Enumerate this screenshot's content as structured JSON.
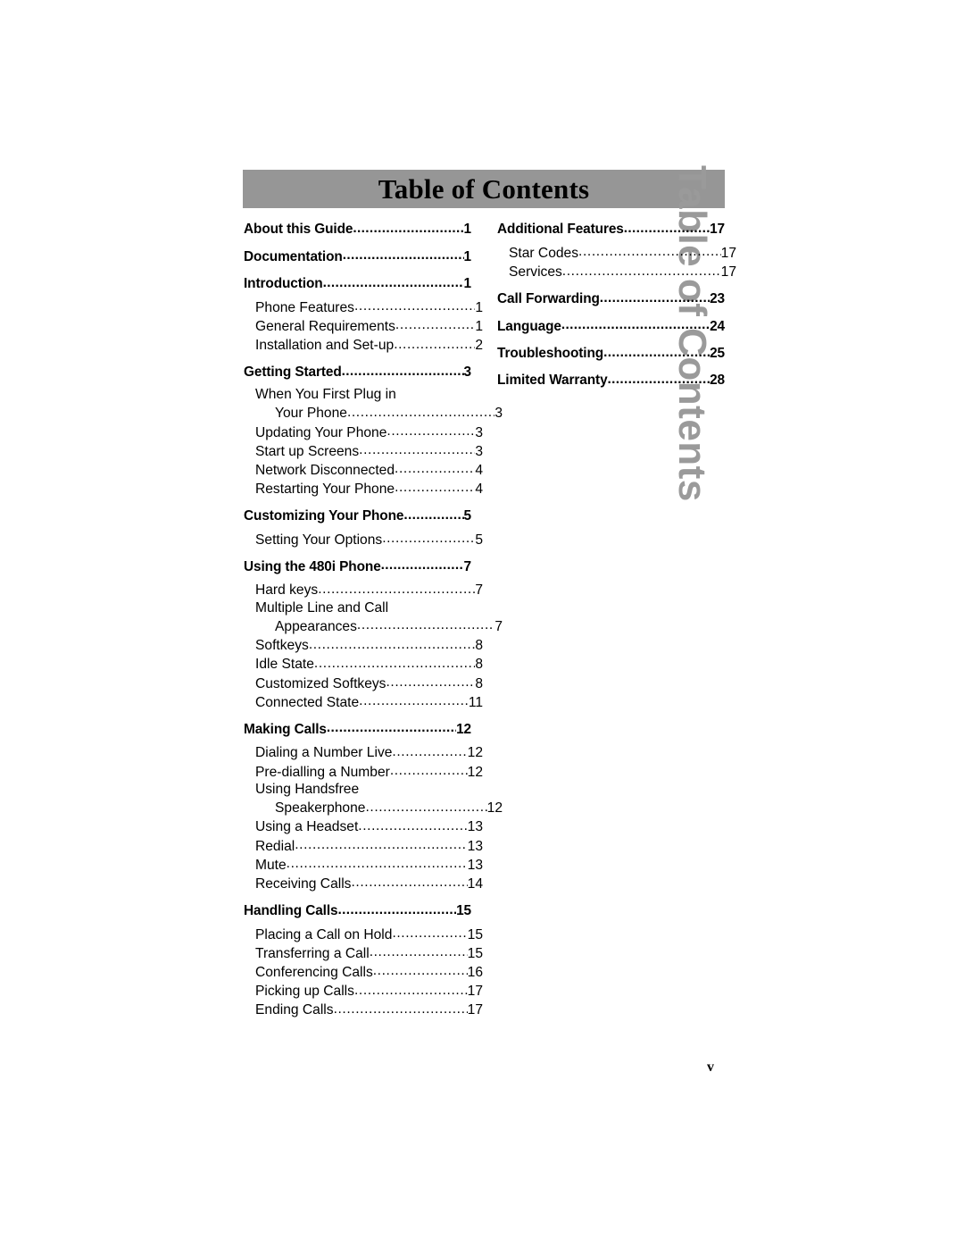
{
  "document": {
    "title": "Table of Contents",
    "side_tab_label": "Table of Contents",
    "folio": "v",
    "banner_color": "#969696",
    "side_tab_color": "#9a9a9a",
    "text_color": "#000000"
  },
  "toc": {
    "left_column": [
      {
        "level": 1,
        "label": "About this Guide",
        "page": "1"
      },
      {
        "level": 1,
        "label": "Documentation",
        "page": "1"
      },
      {
        "level": 1,
        "label": "Introduction",
        "page": "1"
      },
      {
        "level": 2,
        "label": "Phone Features",
        "page": "1"
      },
      {
        "level": 2,
        "label": "General Requirements",
        "page": "1"
      },
      {
        "level": 2,
        "label": "Installation and Set-up",
        "page": "2"
      },
      {
        "level": 1,
        "label": "Getting Started",
        "page": "3"
      },
      {
        "level": 2,
        "label": "When You First Plug in",
        "page": "",
        "wrap_first": true
      },
      {
        "level": 2,
        "label": "Your Phone",
        "page": "3",
        "continuation": true
      },
      {
        "level": 2,
        "label": "Updating Your Phone",
        "page": "3"
      },
      {
        "level": 2,
        "label": "Start up Screens",
        "page": "3"
      },
      {
        "level": 2,
        "label": "Network Disconnected",
        "page": "4"
      },
      {
        "level": 2,
        "label": "Restarting Your Phone",
        "page": "4"
      },
      {
        "level": 1,
        "label": "Customizing Your Phone",
        "page": "5"
      },
      {
        "level": 2,
        "label": "Setting Your Options",
        "page": "5"
      },
      {
        "level": 1,
        "label": "Using the 480i Phone",
        "page": "7"
      },
      {
        "level": 2,
        "label": "Hard keys",
        "page": "7"
      },
      {
        "level": 2,
        "label": "Multiple Line and Call",
        "page": "",
        "wrap_first": true
      },
      {
        "level": 2,
        "label": "Appearances",
        "page": "7",
        "continuation": true
      },
      {
        "level": 2,
        "label": "Softkeys",
        "page": "8"
      },
      {
        "level": 2,
        "label": "Idle State",
        "page": "8"
      },
      {
        "level": 2,
        "label": "Customized Softkeys",
        "page": "8"
      },
      {
        "level": 2,
        "label": "Connected State",
        "page": "11"
      },
      {
        "level": 1,
        "label": "Making Calls",
        "page": "12"
      },
      {
        "level": 2,
        "label": "Dialing a Number Live",
        "page": "12"
      },
      {
        "level": 2,
        "label": "Pre-dialling a Number",
        "page": "12"
      },
      {
        "level": 2,
        "label": "Using Handsfree",
        "page": "",
        "wrap_first": true
      },
      {
        "level": 2,
        "label": "Speakerphone",
        "page": "12",
        "continuation": true
      },
      {
        "level": 2,
        "label": "Using a Headset",
        "page": "13"
      },
      {
        "level": 2,
        "label": "Redial",
        "page": "13"
      },
      {
        "level": 2,
        "label": "Mute",
        "page": "13"
      },
      {
        "level": 2,
        "label": "Receiving Calls",
        "page": "14"
      },
      {
        "level": 1,
        "label": "Handling Calls",
        "page": "15"
      },
      {
        "level": 2,
        "label": "Placing a Call on Hold",
        "page": "15"
      },
      {
        "level": 2,
        "label": "Transferring a Call",
        "page": "15"
      },
      {
        "level": 2,
        "label": "Conferencing Calls",
        "page": "16"
      },
      {
        "level": 2,
        "label": "Picking up Calls",
        "page": "17"
      },
      {
        "level": 2,
        "label": "Ending Calls",
        "page": "17"
      }
    ],
    "right_column": [
      {
        "level": 1,
        "label": "Additional Features",
        "page": "17"
      },
      {
        "level": 2,
        "label": "Star Codes",
        "page": "17"
      },
      {
        "level": 2,
        "label": "Services",
        "page": "17"
      },
      {
        "level": 1,
        "label": "Call Forwarding",
        "page": "23"
      },
      {
        "level": 1,
        "label": "Language",
        "page": "24"
      },
      {
        "level": 1,
        "label": "Troubleshooting",
        "page": "25"
      },
      {
        "level": 1,
        "label": "Limited Warranty",
        "page": "28"
      }
    ]
  }
}
